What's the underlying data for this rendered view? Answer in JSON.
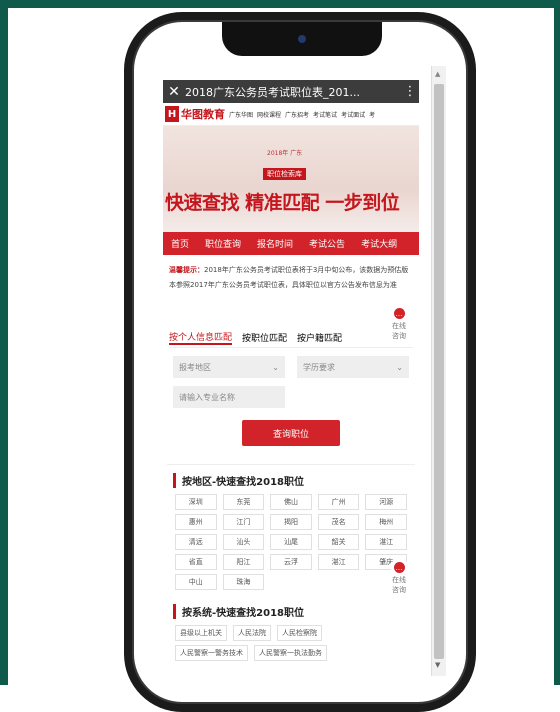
{
  "browser": {
    "title": "2018广东公务员考试职位表_201...",
    "close_icon": "close-icon",
    "more_icon": "more-vertical-icon"
  },
  "site": {
    "logo_mark": "H",
    "logo_text": "华图教育",
    "top_links": [
      "广东华图",
      "网校课程",
      "广东招考",
      "考试笔试",
      "考试面试",
      "考"
    ]
  },
  "banner": {
    "small_text": "2018年 广东",
    "badge": "职位检索库",
    "slogan": "快速查找 精准匹配 一步到位"
  },
  "nav": {
    "items": [
      "首页",
      "职位查询",
      "报名时间",
      "考试公告",
      "考试大纲"
    ]
  },
  "notice": {
    "label": "温馨提示：",
    "text": "2018年广东公务员考试职位表将于3月中旬公布，该数据为预估版本参照2017年广东公务员考试职位表，具体职位以官方公告发布信息为准"
  },
  "tabs": {
    "items": [
      "按个人信息匹配",
      "按职位匹配",
      "按户籍匹配"
    ],
    "active_index": 0
  },
  "form": {
    "region_select": "报考地区",
    "edu_select": "学历要求",
    "major_placeholder": "请输入专业名称",
    "query_button": "查询职位"
  },
  "region_section": {
    "title": "按地区-快速查找2018职位",
    "cities": [
      "深圳",
      "东莞",
      "佛山",
      "广州",
      "河源",
      "惠州",
      "江门",
      "揭阳",
      "茂名",
      "梅州",
      "清远",
      "汕头",
      "汕尾",
      "韶关",
      "湛江",
      "省直",
      "阳江",
      "云浮",
      "湛江",
      "肇庆",
      "中山",
      "珠海"
    ]
  },
  "system_section": {
    "title": "按系统-快速查找2018职位",
    "items_row1": [
      "县级以上机关",
      "人民法院",
      "人民检察院"
    ],
    "items_row2": [
      "人民警察一警务技术",
      "人民警察一执法勤务"
    ]
  },
  "consult": {
    "label": "在线咨询"
  }
}
